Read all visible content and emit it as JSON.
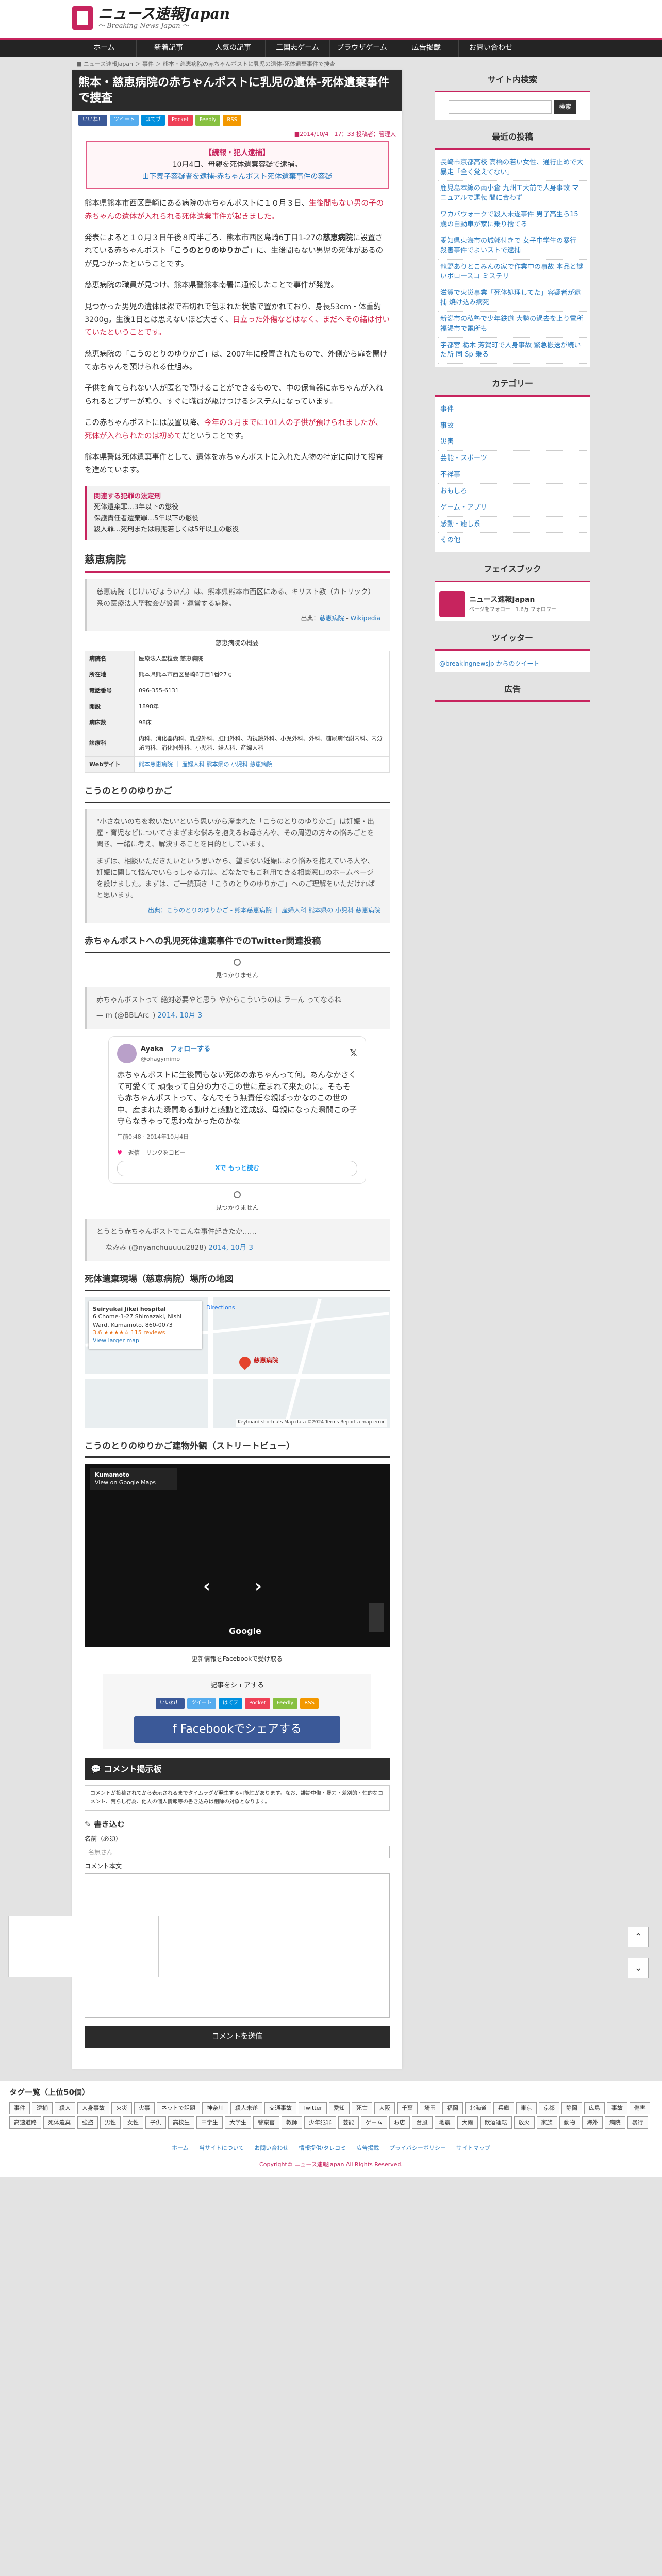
{
  "site": {
    "title": "ニュース速報Japan",
    "subtitle": "～ Breaking News Japan ～"
  },
  "nav": [
    "ホーム",
    "新着記事",
    "人気の記事",
    "三国志ゲーム",
    "ブラウザゲーム",
    "広告掲載",
    "お問い合わせ"
  ],
  "breadcrumb": "■ ニュース速報Japan ＞ 事件 ＞ 熊本・慈恵病院の赤ちゃんポストに乳児の遺体-死体遺棄事件で捜査",
  "article": {
    "title": "熊本・慈恵病院の赤ちゃんポストに乳児の遺体-死体遺棄事件で捜査",
    "share_buttons": [
      "いいね！",
      "ツイート",
      "はてブ",
      "Pocket",
      "Feedly",
      "RSS"
    ],
    "date": "■2014/10/4　17：33 投稿者：管理人",
    "notice_head": "【続報・犯人逮捕】",
    "notice_date": "10月4日、母親を死体遺棄容疑で逮捕。",
    "notice_link": "山下舞子容疑者を逮捕-赤ちゃんポスト死体遺棄事件の容疑",
    "p1a": "熊本県熊本市西区島崎にある病院の赤ちゃんポストに１０月３日、",
    "p1b": "生後間もない男の子の赤ちゃんの遺体が入れられる死体遺棄事件が起きました。",
    "p2a": "発表によると１０月３日午後８時半ごろ、熊本市西区島崎6丁目1-27の",
    "p2b": "慈恵病院",
    "p2c": "に設置されている赤ちゃんポスト「",
    "p2d": "こうのとりのゆりかご",
    "p2e": "」に、生後間もない男児の死体があるのが見つかったということです。",
    "p3": "慈恵病院の職員が見つけ、熊本県警熊本南署に通報したことで事件が発覚。",
    "p4a": "見つかった男児の遺体は裸で布切れで包まれた状態で置かれており、身長53cm・体重約3200g。生後1日とは思えないほど大きく、",
    "p4b": "目立った外傷などはなく、まだへその緒は付いていたということです。",
    "p5a": "慈恵病院の「こうのとりのゆりかご」は、2007年に設置されたもので、外側から扉を開けて赤ちゃんを預けられる仕組み。",
    "p6": "子供を育てられない人が匿名で預けることができるもので、中の保育器に赤ちゃんが入れられるとブザーが鳴り、すぐに職員が駆けつけるシステムになっています。",
    "p7a": "この赤ちゃんポストには設置以降、",
    "p7b": "今年の３月までに101人の子供が預けられましたが、死体が入れられたのは初めて",
    "p7c": "だということです。",
    "p8": "熊本県警は死体遺棄事件として、遺体を赤ちゃんポストに入れた人物の特定に向けて捜査を進めています。",
    "rel_head": "関連する犯罪の法定刑",
    "rel_items": [
      "死体遺棄罪…3年以下の懲役",
      "保護責任者遺棄罪…5年以下の懲役",
      "殺人罪…死刑または無期若しくは5年以上の懲役"
    ]
  },
  "hospital": {
    "heading": "慈恵病院",
    "quote": "慈恵病院（じけいびょういん）は、熊本県熊本市西区にある、キリスト教（カトリック）系の医療法人聖粒会が設置・運営する病院。",
    "source_prefix": "出典：",
    "source_links": [
      "慈恵病院",
      "Wikipedia"
    ],
    "table_caption": "慈恵病院の概要",
    "rows": [
      {
        "k": "病院名",
        "v": "医療法人聖粒会 慈恵病院"
      },
      {
        "k": "所在地",
        "v": "熊本県熊本市西区島崎6丁目1番27号"
      },
      {
        "k": "電話番号",
        "v": "096-355-6131"
      },
      {
        "k": "開設",
        "v": "1898年"
      },
      {
        "k": "病床数",
        "v": "98床"
      },
      {
        "k": "診療科",
        "v": "内科、消化器内科、乳腺外科、肛門外科、内視鏡外科、小児外科、外科、糖尿病代謝内科、内分泌内科、消化器外科、小児科、婦人科、産婦人科"
      },
      {
        "k": "Webサイト",
        "v": "熊本慈恵病院 ｜ 産婦人科 熊本県の 小児科 慈恵病院"
      }
    ]
  },
  "cradle": {
    "heading": "こうのとりのゆりかご",
    "quote1": "\"小さないのちを救いたい\"という思いから産まれた「こうのとりのゆりかご」は妊娠・出産・育児などについてさまざまな悩みを抱えるお母さんや、その周辺の方々の悩みごとを聞き、一緒に考え、解決することを目的としています。",
    "quote2": "まずは、相談いただきたいという思いから、望まない妊娠により悩みを抱えている人や、妊娠に関して悩んでいらっしゃる方は、どなたでもご利用できる相談窓口のホームページを設けました。まずは、ご一読頂き「こうのとりのゆりかご」へのご理解をいただければと思います。",
    "source": "出典：こうのとりのゆりかご - 熊本慈恵病院 ｜ 産婦人科 熊本県の 小児科 慈恵病院"
  },
  "twitter": {
    "heading": "赤ちゃんポストへの乳児死体遺棄事件でのTwitter関連投稿",
    "unavailable": "見つかりません",
    "q1": "赤ちゃんポストって 絶対必要やと思う やからこういうのは ラーん ってなるね",
    "q1by": "— m (@BBLArc_) ",
    "q1date": "2014, 10月 3",
    "tw_name": "Ayaka",
    "tw_handle": "@ohagymimo",
    "tw_follow": "フォローする",
    "tw_body": "赤ちゃんポストに生後間もない死体の赤ちゃんって何。あんなかさくて可愛くて 頑張って自分の力でこの世に産まれて来たのに。そもそも赤ちゃんポストって、なんでそう無責任な親ばっかなのこの世の中、産まれた瞬間ある動けと感動と達成感、母親になった瞬間この子守らなきゃって思わなかったのかな",
    "tw_time": "午前0:48 · 2014年10月4日",
    "tw_actions": [
      "返信",
      "リンクをコピー"
    ],
    "tw_more": "Xで もっと読む",
    "q2": "とうとう赤ちゃんポストでこんな事件起きたか……",
    "q2by": "— なみみ (@nyanchuuuuu2828) ",
    "q2date": "2014, 10月 3"
  },
  "map": {
    "heading": "死体遺棄現場（慈恵病院）場所の地図",
    "place": "Seiryukai Jikei hospital",
    "addr": "6 Chome-1-27 Shimazaki, Nishi Ward, Kumamoto, 860-0073",
    "rating": "3.6 ★★★★☆ 115 reviews",
    "larger": "View larger map",
    "dir": "Directions",
    "pin_label": "慈恵病院",
    "footer": "Keyboard shortcuts  Map data ©2024  Terms  Report a map error"
  },
  "street": {
    "heading": "こうのとりのゆりかご建物外観（ストリートビュー）",
    "label": "Kumamoto",
    "label_sub": "View on Google Maps",
    "logo": "Google",
    "note": "更新情報をFacebookで受け取る"
  },
  "sharebox": {
    "label": "記事をシェアする",
    "fb": "Facebookでシェアする"
  },
  "comments": {
    "heading": "コメント掲示板",
    "note": "コメントが投稿されてから表示されるまでタイムラグが発生する可能性があります。なお、誹謗中傷・暴力・差別的・性的なコメント、荒らし行為、他人の個人情報等の書き込みは削除の対象となります。",
    "form_head": "書き込む",
    "name_label": "名前（必須）",
    "name_ph": "名無さん",
    "body_label": "コメント本文",
    "submit": "コメントを送信"
  },
  "sidebar": {
    "search_head": "サイト内検索",
    "search_btn": "検索",
    "recent_head": "最近の投稿",
    "recent": [
      "長崎市京都高校 高橋の若い女性、通行止めで大暴走「全く覚えてない」",
      "鹿児島本線の南小倉 九州工大前で人身事故 マニュアルで運転 間に合わず",
      "ワカバウォークで殺人未遂事件 男子高生ら15歳の自動車が家に乗り捨てる",
      "愛知県東海市の城郭付きで 女子中学生の暴行 殺害事件でよいストで逮捕",
      "龍野ありとこみんの家で作業中の事故 本品と謎いボロースコ ミステリ",
      "滋賀で火災事業「死体処理してた」容疑者が逮捕 焼け込み病死",
      "新潟市の私塾で少年鉄道 大勢の過去を上り電所 福湯市で電所も",
      "宇都宮 栃木 芳賀町で人身事故 緊急搬送が続いた所 同 Sp 乗る"
    ],
    "cat_head": "カテゴリー",
    "cats": [
      "事件",
      "事故",
      "災害",
      "芸能・スポーツ",
      "不祥事",
      "おもしろ",
      "ゲーム・アプリ",
      "感動・癒し系",
      "その他"
    ],
    "fb_head": "フェイスブック",
    "fb_name": "ニュース速報Japan",
    "fb_sub": "ページをフォロー　1.6万 フォロワー",
    "tw_head": "ツイッター",
    "tw_link": "@breakingnewsjp からのツイート",
    "ad_head": "広告"
  },
  "tags": {
    "head": "タグ一覧（上位50個）",
    "items": [
      "事件",
      "逮捕",
      "殺人",
      "人身事故",
      "火災",
      "火事",
      "ネットで話題",
      "神奈川",
      "殺人未遂",
      "交通事故",
      "Twitter",
      "愛知",
      "死亡",
      "大阪",
      "千葉",
      "埼玉",
      "福岡",
      "北海道",
      "兵庫",
      "東京",
      "京都",
      "静岡",
      "広島",
      "事故",
      "傷害",
      "高速道路",
      "死体遺棄",
      "強盗",
      "男性",
      "女性",
      "子供",
      "高校生",
      "中学生",
      "大学生",
      "警察官",
      "教師",
      "少年犯罪",
      "芸能",
      "ゲーム",
      "お店",
      "台風",
      "地震",
      "大雨",
      "飲酒運転",
      "放火",
      "家族",
      "動物",
      "海外",
      "病院",
      "暴行"
    ]
  },
  "footer": {
    "links": [
      "ホーム",
      "当サイトについて",
      "お問い合わせ",
      "情報提供/タレコミ",
      "広告掲載",
      "プライバシーポリシー",
      "サイトマップ"
    ],
    "copy": "Copyright© ニュース速報Japan All Rights Reserved."
  }
}
